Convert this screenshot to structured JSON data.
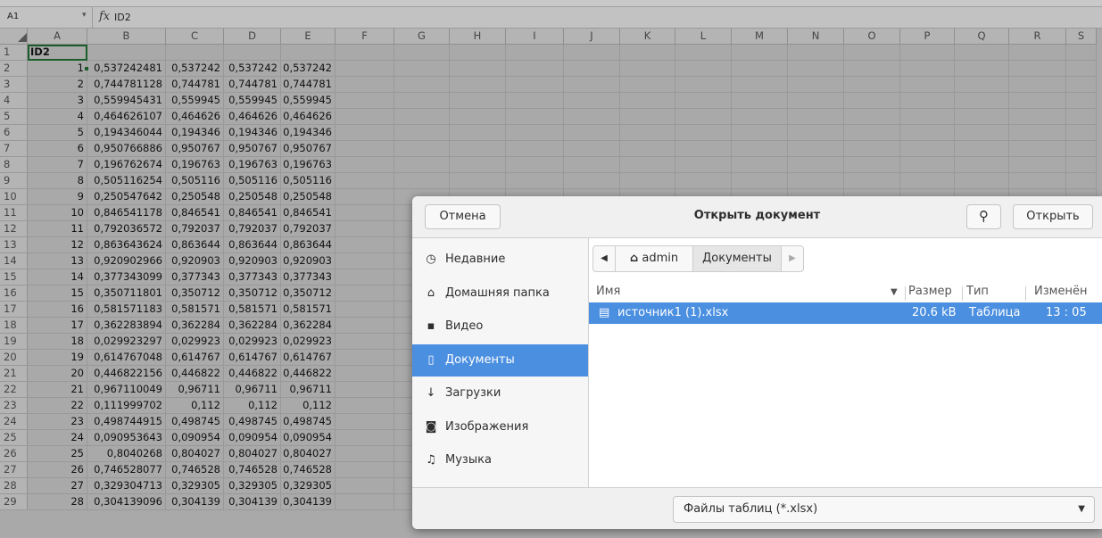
{
  "formula_bar": {
    "cell_ref": "A1",
    "fx": "fx",
    "content": "ID2"
  },
  "columns": [
    "A",
    "B",
    "C",
    "D",
    "E",
    "F",
    "G",
    "H",
    "I",
    "J",
    "K",
    "L",
    "M",
    "N",
    "O",
    "P",
    "Q",
    "R",
    "S"
  ],
  "header_row": {
    "num": "1",
    "a": "ID2"
  },
  "rows": [
    {
      "num": "2",
      "a": "1",
      "b": "0,537242481",
      "c": "0,537242",
      "d": "0,537242",
      "e": "0,537242"
    },
    {
      "num": "3",
      "a": "2",
      "b": "0,744781128",
      "c": "0,744781",
      "d": "0,744781",
      "e": "0,744781"
    },
    {
      "num": "4",
      "a": "3",
      "b": "0,559945431",
      "c": "0,559945",
      "d": "0,559945",
      "e": "0,559945"
    },
    {
      "num": "5",
      "a": "4",
      "b": "0,464626107",
      "c": "0,464626",
      "d": "0,464626",
      "e": "0,464626"
    },
    {
      "num": "6",
      "a": "5",
      "b": "0,194346044",
      "c": "0,194346",
      "d": "0,194346",
      "e": "0,194346"
    },
    {
      "num": "7",
      "a": "6",
      "b": "0,950766886",
      "c": "0,950767",
      "d": "0,950767",
      "e": "0,950767"
    },
    {
      "num": "8",
      "a": "7",
      "b": "0,196762674",
      "c": "0,196763",
      "d": "0,196763",
      "e": "0,196763"
    },
    {
      "num": "9",
      "a": "8",
      "b": "0,505116254",
      "c": "0,505116",
      "d": "0,505116",
      "e": "0,505116"
    },
    {
      "num": "10",
      "a": "9",
      "b": "0,250547642",
      "c": "0,250548",
      "d": "0,250548",
      "e": "0,250548"
    },
    {
      "num": "11",
      "a": "10",
      "b": "0,846541178",
      "c": "0,846541",
      "d": "0,846541",
      "e": "0,846541"
    },
    {
      "num": "12",
      "a": "11",
      "b": "0,792036572",
      "c": "0,792037",
      "d": "0,792037",
      "e": "0,792037"
    },
    {
      "num": "13",
      "a": "12",
      "b": "0,863643624",
      "c": "0,863644",
      "d": "0,863644",
      "e": "0,863644"
    },
    {
      "num": "14",
      "a": "13",
      "b": "0,920902966",
      "c": "0,920903",
      "d": "0,920903",
      "e": "0,920903"
    },
    {
      "num": "15",
      "a": "14",
      "b": "0,377343099",
      "c": "0,377343",
      "d": "0,377343",
      "e": "0,377343"
    },
    {
      "num": "16",
      "a": "15",
      "b": "0,350711801",
      "c": "0,350712",
      "d": "0,350712",
      "e": "0,350712"
    },
    {
      "num": "17",
      "a": "16",
      "b": "0,581571183",
      "c": "0,581571",
      "d": "0,581571",
      "e": "0,581571"
    },
    {
      "num": "18",
      "a": "17",
      "b": "0,362283894",
      "c": "0,362284",
      "d": "0,362284",
      "e": "0,362284"
    },
    {
      "num": "19",
      "a": "18",
      "b": "0,029923297",
      "c": "0,029923",
      "d": "0,029923",
      "e": "0,029923"
    },
    {
      "num": "20",
      "a": "19",
      "b": "0,614767048",
      "c": "0,614767",
      "d": "0,614767",
      "e": "0,614767"
    },
    {
      "num": "21",
      "a": "20",
      "b": "0,446822156",
      "c": "0,446822",
      "d": "0,446822",
      "e": "0,446822"
    },
    {
      "num": "22",
      "a": "21",
      "b": "0,967110049",
      "c": "0,96711",
      "d": "0,96711",
      "e": "0,96711"
    },
    {
      "num": "23",
      "a": "22",
      "b": "0,111999702",
      "c": "0,112",
      "d": "0,112",
      "e": "0,112"
    },
    {
      "num": "24",
      "a": "23",
      "b": "0,498744915",
      "c": "0,498745",
      "d": "0,498745",
      "e": "0,498745"
    },
    {
      "num": "25",
      "a": "24",
      "b": "0,090953643",
      "c": "0,090954",
      "d": "0,090954",
      "e": "0,090954"
    },
    {
      "num": "26",
      "a": "25",
      "b": "0,8040268",
      "c": "0,804027",
      "d": "0,804027",
      "e": "0,804027"
    },
    {
      "num": "27",
      "a": "26",
      "b": "0,746528077",
      "c": "0,746528",
      "d": "0,746528",
      "e": "0,746528"
    },
    {
      "num": "28",
      "a": "27",
      "b": "0,329304713",
      "c": "0,329305",
      "d": "0,329305",
      "e": "0,329305"
    },
    {
      "num": "29",
      "a": "28",
      "b": "0,304139096",
      "c": "0,304139",
      "d": "0,304139",
      "e": "0,304139"
    }
  ],
  "dialog": {
    "title": "Открыть документ",
    "cancel": "Отмена",
    "open": "Открыть",
    "sidebar": [
      {
        "icon": "clock-icon",
        "glyph": "◷",
        "label": "Недавние"
      },
      {
        "icon": "home-icon",
        "glyph": "⌂",
        "label": "Домашняя папка"
      },
      {
        "icon": "video-icon",
        "glyph": "▪",
        "label": "Видео"
      },
      {
        "icon": "document-icon",
        "glyph": "▯",
        "label": "Документы",
        "active": true
      },
      {
        "icon": "download-icon",
        "glyph": "↓",
        "label": "Загрузки"
      },
      {
        "icon": "camera-icon",
        "glyph": "◙",
        "label": "Изображения"
      },
      {
        "icon": "music-icon",
        "glyph": "♫",
        "label": "Музыка"
      }
    ],
    "path": {
      "back": "◀",
      "home_label": "admin",
      "current": "Документы",
      "forward": "▶"
    },
    "columns": {
      "name": "Имя",
      "size": "Размер",
      "type": "Тип",
      "modified": "Изменён"
    },
    "file": {
      "name": "источник1 (1).xlsx",
      "size": "20.6 kB",
      "type": "Таблица",
      "modified": "13 : 05"
    },
    "filter": "Файлы таблиц (*.xlsx)"
  },
  "colors": {
    "accent": "#4b8fe0",
    "selection_border": "#1a5d2a"
  }
}
